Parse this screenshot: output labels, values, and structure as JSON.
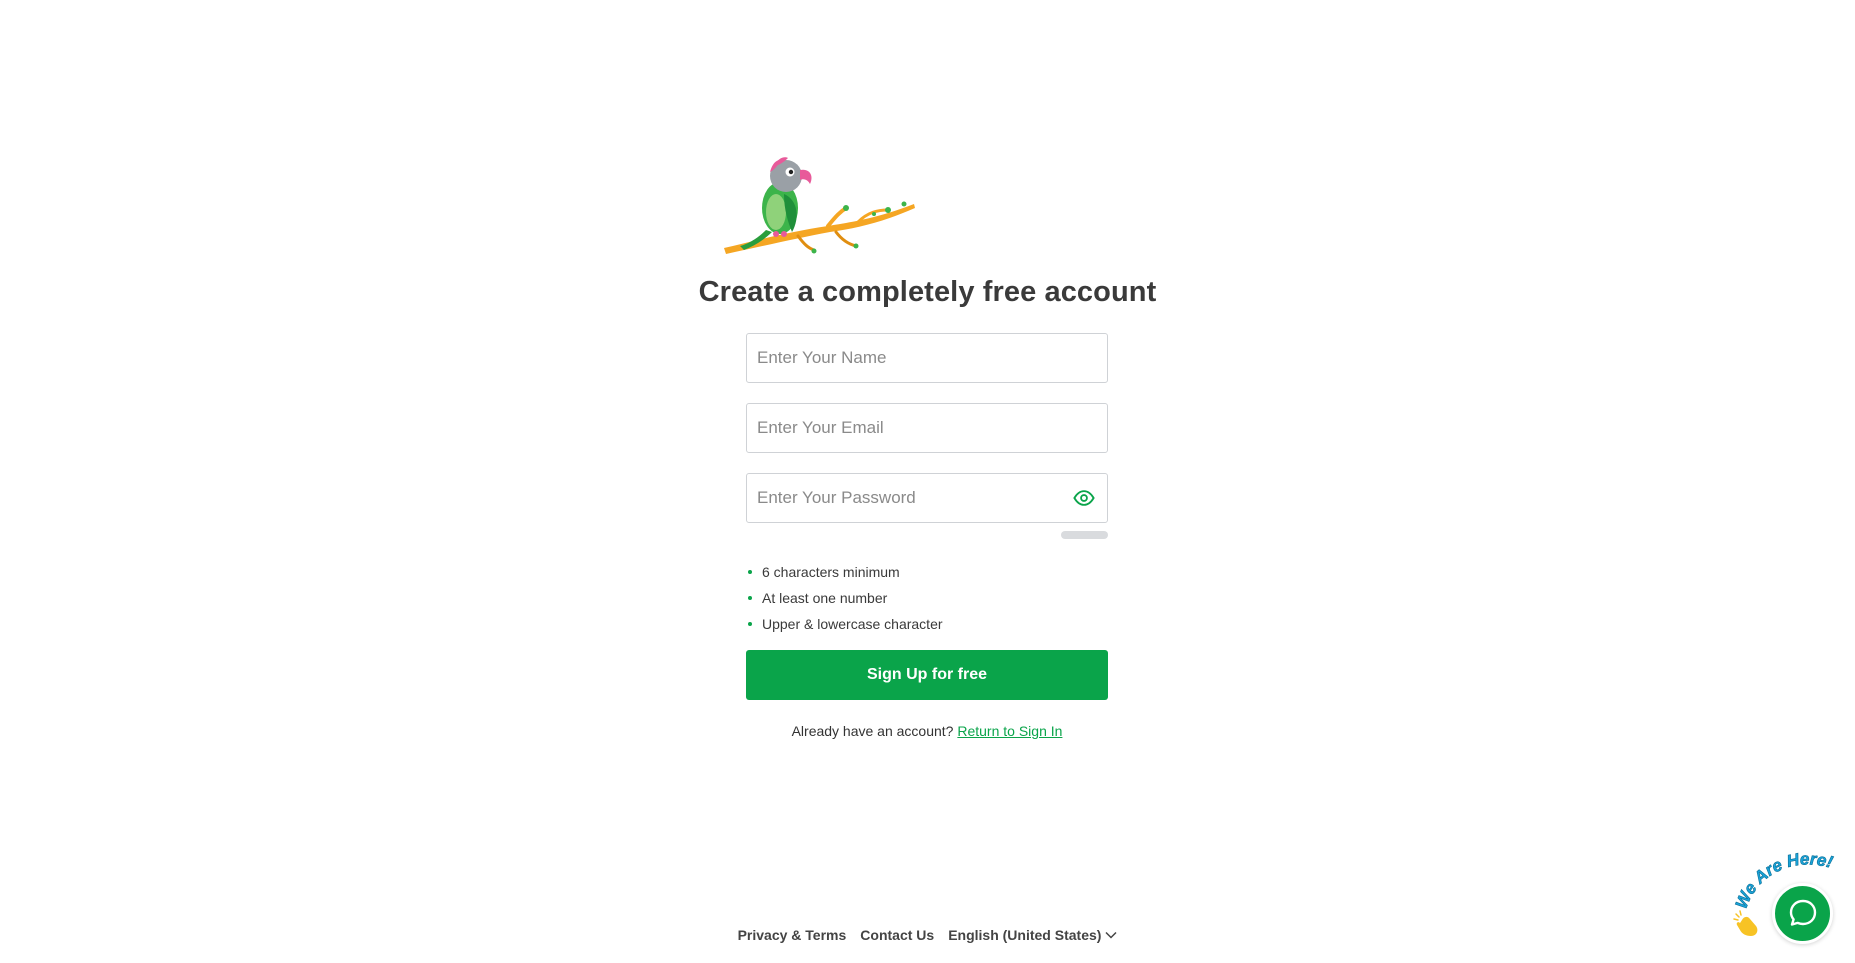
{
  "title": "Create a completely free account",
  "form": {
    "name_placeholder": "Enter Your Name",
    "email_placeholder": "Enter Your Email",
    "password_placeholder": "Enter Your Password",
    "rules": [
      "6 characters minimum",
      "At least one number",
      "Upper & lowercase character"
    ],
    "signup_label": "Sign Up for free",
    "signin_prompt": "Already have an account?",
    "signin_link": "Return to Sign In"
  },
  "footer": {
    "privacy": "Privacy & Terms",
    "contact": "Contact Us",
    "language": "English (United States)"
  },
  "chat": {
    "badge_text": "We Are Here!"
  },
  "colors": {
    "brand_green": "#0aa44a",
    "branch_orange": "#f5a623"
  },
  "icons": {
    "logo": "parrot-on-branch",
    "password_toggle": "eye-icon",
    "language_menu": "chevron-down-icon",
    "chat": "chat-bubble-icon",
    "wave": "waving-hand-icon"
  }
}
